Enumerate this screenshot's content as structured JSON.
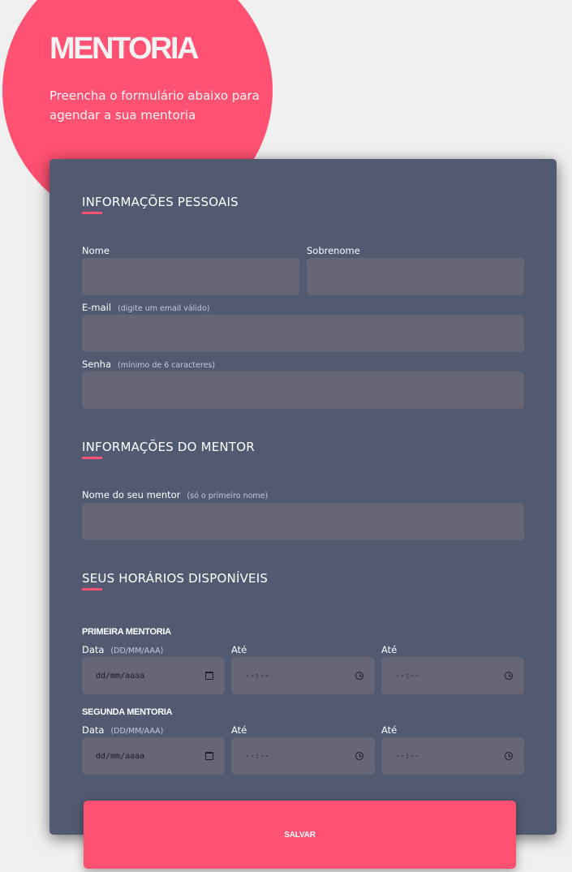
{
  "hero": {
    "title": "MENTORIA",
    "subtitle": "Preencha o formulário abaixo para agendar a sua mentoria"
  },
  "personal": {
    "title": "INFORMAÇÕES PESSOAIS",
    "first_name_label": "Nome",
    "last_name_label": "Sobrenome",
    "email_label": "E-mail",
    "email_hint": "(digite um email válido)",
    "password_label": "Senha",
    "password_hint": "(mínimo de 6 caracteres)"
  },
  "mentor": {
    "title": "INFORMAÇÕES DO MENTOR",
    "name_label": "Nome do seu mentor",
    "name_hint": "(só o primeiro nome)"
  },
  "schedule": {
    "title": "SEUS HORÁRIOS DISPONÍVEIS",
    "date_label": "Data",
    "date_hint": "(DD/MM/AAA)",
    "until_label": "Até",
    "date_placeholder": "dd/mm/aaaa",
    "time_placeholder": "--:--",
    "first": {
      "heading": "PRIMEIRA MENTORIA"
    },
    "second": {
      "heading": "SEGUNDA MENTORIA"
    }
  },
  "submit": {
    "label": "SALVAR"
  },
  "colors": {
    "accent": "#ff5172",
    "card": "#525a71",
    "field": "#676676",
    "background": "#f0f0f0"
  }
}
